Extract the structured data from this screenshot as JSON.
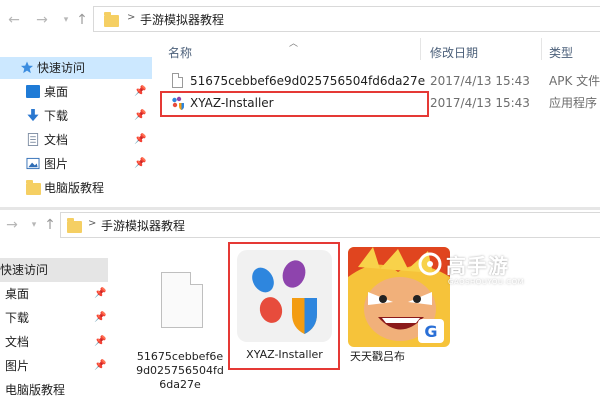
{
  "top_explorer": {
    "nav": {
      "back_label": "←",
      "forward_label": "→"
    },
    "breadcrumb": {
      "separator": ">",
      "folder": "手游模拟器教程"
    },
    "sidebar": [
      {
        "label": "快速访问",
        "icon": "star-icon",
        "selected": true
      },
      {
        "label": "桌面",
        "icon": "desktop-icon",
        "pinned": true
      },
      {
        "label": "下载",
        "icon": "download-icon",
        "pinned": true
      },
      {
        "label": "文档",
        "icon": "document-icon",
        "pinned": true
      },
      {
        "label": "图片",
        "icon": "picture-icon",
        "pinned": true
      },
      {
        "label": "电脑版教程",
        "icon": "folder-icon",
        "pinned": false
      }
    ],
    "columns": {
      "name": "名称",
      "modified": "修改日期",
      "type": "类型"
    },
    "files": [
      {
        "name": "51675cebbef6e9d025756504fd6da27e",
        "modified": "2017/4/13 15:43",
        "type": "APK 文件",
        "icon": "file-icon"
      },
      {
        "name": "XYAZ-Installer",
        "modified": "2017/4/13 15:43",
        "type": "应用程序",
        "icon": "installer-icon",
        "highlighted": true
      }
    ]
  },
  "bottom_explorer": {
    "breadcrumb": {
      "separator": ">",
      "folder": "手游模拟器教程"
    },
    "sidebar": [
      {
        "label": "快速访问",
        "selected": true
      },
      {
        "label": "桌面",
        "pinned": true
      },
      {
        "label": "下载",
        "pinned": true
      },
      {
        "label": "文档",
        "pinned": true
      },
      {
        "label": "图片",
        "pinned": true
      },
      {
        "label": "电脑版教程"
      }
    ],
    "tiles": [
      {
        "name_lines": [
          "51675cebbef6e",
          "9d025756504fd",
          "6da27e"
        ],
        "icon": "file-icon"
      },
      {
        "name": "XYAZ-Installer",
        "icon": "installer-icon",
        "highlighted": true
      },
      {
        "name": "天天戳吕布",
        "icon": "game-app-icon"
      }
    ]
  },
  "watermark": {
    "brand": "高手游",
    "domain": "GAOSHOUYOU.COM"
  },
  "colors": {
    "highlight_red": "#e53935",
    "selection_blue": "#cce8ff",
    "folder_yellow": "#f5cf63",
    "header_text": "#4c607a"
  }
}
